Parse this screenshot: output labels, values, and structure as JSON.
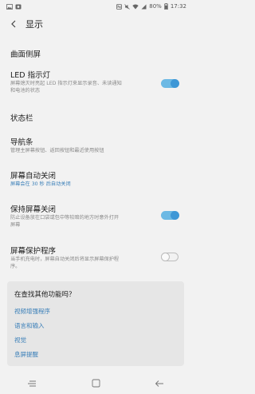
{
  "status_bar": {
    "battery": "80%",
    "time": "17:32"
  },
  "header": {
    "title": "显示"
  },
  "items": [
    {
      "title": "曲面侧屏"
    },
    {
      "title": "LED 指示灯",
      "subtitle_lines": [
        "屏幕熄灭时亮起 LED 指示灯来显示录音、未读通知",
        "和电池的状态"
      ],
      "toggle": "on"
    },
    {
      "title": "状态栏"
    },
    {
      "title": "导航条",
      "subtitle_lines": [
        "管理主屏幕按钮、返回按钮和最近使用按钮"
      ]
    },
    {
      "title": "屏幕自动关闭",
      "subtitle_lines": [
        "屏幕会在 30 秒 后自动关闭"
      ],
      "subtitle_color": "blue"
    },
    {
      "title": "保持屏幕关闭",
      "subtitle_lines": [
        "防止设备放在口袋或包中等较暗的地方时意外打开",
        "屏幕"
      ],
      "toggle": "on"
    },
    {
      "title": "屏幕保护程序",
      "subtitle_lines": [
        "当手机充电时，屏幕自动关闭后将显示屏幕保护程",
        "序。"
      ],
      "toggle": "off"
    }
  ],
  "suggestions": {
    "title": "在查找其他功能吗？",
    "links": [
      "视频增强程序",
      "语言和输入",
      "视觉",
      "息屏提醒"
    ]
  },
  "colors": {
    "accent": "#3d97d6",
    "link": "#3a7fb8",
    "background": "#f2f2f2"
  }
}
